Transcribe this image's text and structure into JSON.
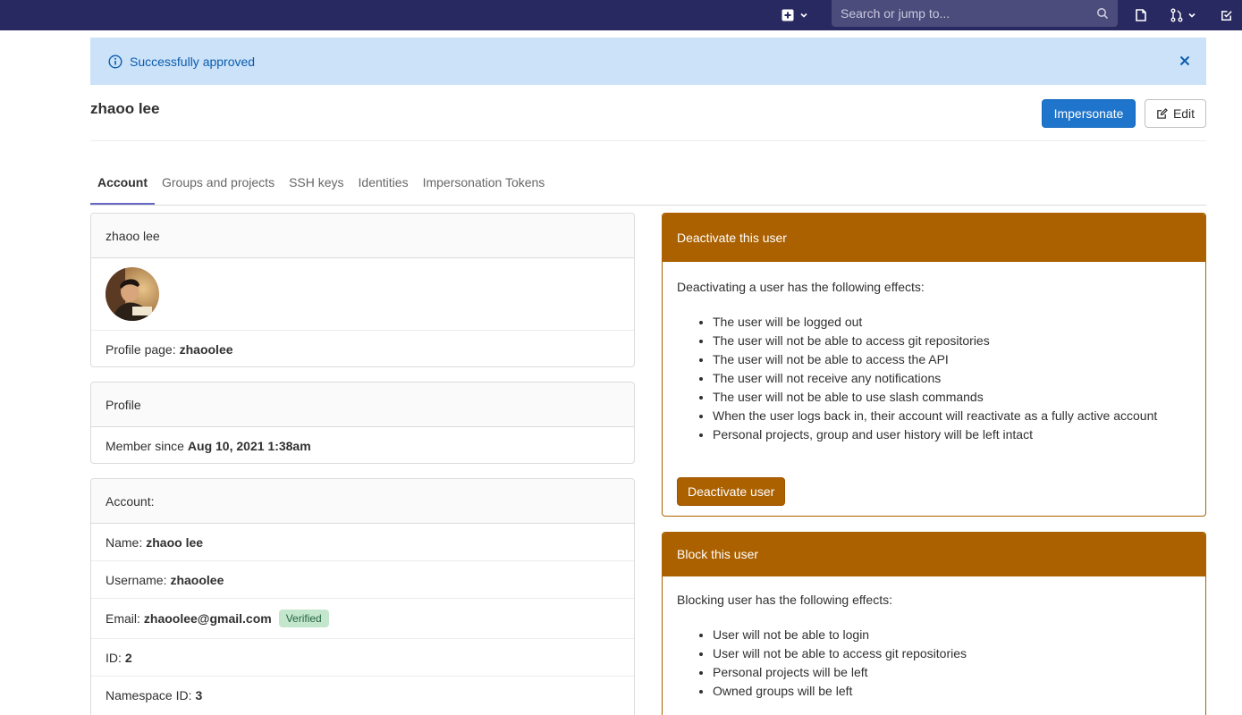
{
  "nav": {
    "search_placeholder": "Search or jump to...",
    "bg_color": "#292961"
  },
  "alert": {
    "message": "Successfully approved"
  },
  "header": {
    "title": "zhaoo lee",
    "impersonate_label": "Impersonate",
    "edit_label": "Edit"
  },
  "tabs": [
    {
      "label": "Account",
      "active": true
    },
    {
      "label": "Groups and projects"
    },
    {
      "label": "SSH keys"
    },
    {
      "label": "Identities"
    },
    {
      "label": "Impersonation Tokens"
    }
  ],
  "user_card": {
    "name": "zhaoo lee",
    "profile_label": "Profile page:",
    "profile_value": "zhaoolee"
  },
  "profile_card": {
    "title": "Profile",
    "member_label": "Member since",
    "member_value": "Aug 10, 2021 1:38am"
  },
  "account_card": {
    "title": "Account:",
    "name_label": "Name:",
    "name_value": "zhaoo lee",
    "username_label": "Username:",
    "username_value": "zhaoolee",
    "email_label": "Email:",
    "email_value": "zhaoolee@gmail.com",
    "email_badge": "Verified",
    "id_label": "ID:",
    "id_value": "2",
    "namespace_label": "Namespace ID:",
    "namespace_value": "3"
  },
  "deactivate": {
    "title": "Deactivate this user",
    "intro": "Deactivating a user has the following effects:",
    "effects": [
      "The user will be logged out",
      "The user will not be able to access git repositories",
      "The user will not be able to access the API",
      "The user will not receive any notifications",
      "The user will not be able to use slash commands",
      "When the user logs back in, their account will reactivate as a fully active account",
      "Personal projects, group and user history will be left intact"
    ],
    "button": "Deactivate user"
  },
  "block": {
    "title": "Block this user",
    "intro": "Blocking user has the following effects:",
    "effects": [
      "User will not be able to login",
      "User will not be able to access git repositories",
      "Personal projects will be left",
      "Owned groups will be left"
    ]
  },
  "colors": {
    "primary": "#1f75cb",
    "warning": "#ab6100",
    "alert_bg": "#cbe2f9"
  }
}
